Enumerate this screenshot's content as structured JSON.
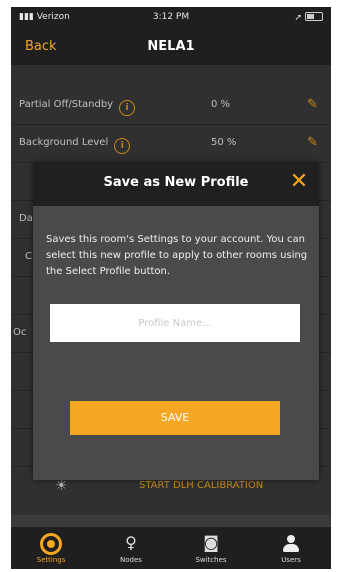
{
  "status_bar": {
    "carrier": "Verizon",
    "time": "3:12 PM"
  },
  "nav": {
    "back_label": "Back",
    "title": "NELA1"
  },
  "settings_rows": [
    {
      "label": "Partial Off/Standby",
      "value": "0 %"
    },
    {
      "label": "Background Level",
      "value": "50 %"
    }
  ],
  "partial_labels": {
    "row3": "Da",
    "row4": "C",
    "row6": "Oc"
  },
  "calibration": {
    "label": "START DLH CALIBRATION"
  },
  "modal": {
    "title": "Save as New Profile",
    "close_icon": "close-icon",
    "description": "Saves this room's Settings to your account. You can select this new profile to apply to other rooms using the Select Profile button.",
    "input_placeholder": "Profile Name...",
    "input_value": "",
    "save_label": "SAVE"
  },
  "tabs": [
    {
      "label": "Settings",
      "icon": "settings-icon",
      "active": true
    },
    {
      "label": "Nodes",
      "icon": "lightbulb-icon",
      "active": false
    },
    {
      "label": "Switches",
      "icon": "switch-icon",
      "active": false
    },
    {
      "label": "Users",
      "icon": "user-icon",
      "active": false
    }
  ],
  "colors": {
    "accent": "#f5a623",
    "background": "#3b3b3b",
    "bar": "#1f1f1f"
  }
}
